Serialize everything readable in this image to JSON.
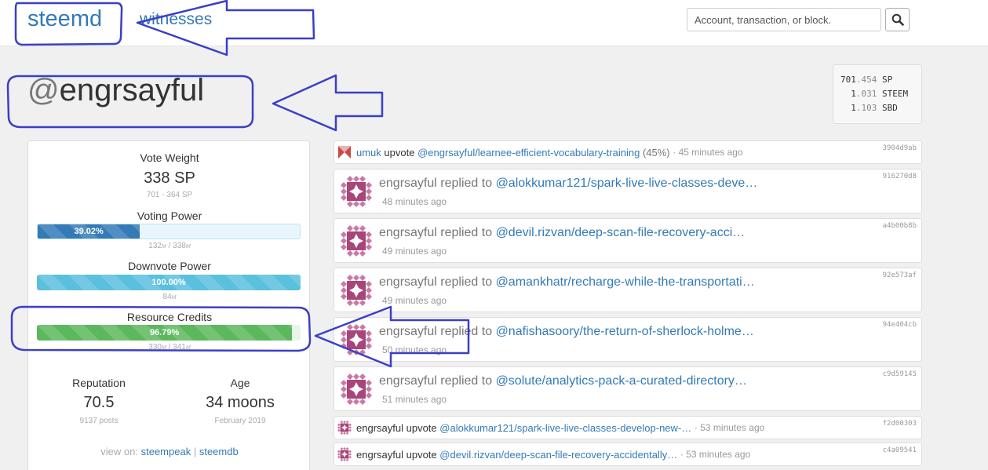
{
  "header": {
    "brand": "steemd",
    "nav_witnesses": "witnesses",
    "search_placeholder": "Account, transaction, or block."
  },
  "account": {
    "at": "@",
    "name": "engrsayful"
  },
  "balances": [
    {
      "int": "701",
      "dec": ".454",
      "unit": "SP"
    },
    {
      "int": "1",
      "dec": ".031",
      "unit": "STEEM"
    },
    {
      "int": "1",
      "dec": ".103",
      "unit": "SBD"
    }
  ],
  "sidebar": {
    "vote_weight": {
      "label": "Vote Weight",
      "value": "338 SP",
      "sub": "701 - 364 SP"
    },
    "voting_power": {
      "label": "Voting Power",
      "percent": 39.02,
      "percent_label": "39.02%",
      "cur": "132",
      "max": "338",
      "unit": "M"
    },
    "downvote_power": {
      "label": "Downvote Power",
      "percent": 100,
      "percent_label": "100.00%",
      "cur": "84",
      "unit": "M"
    },
    "resource_credits": {
      "label": "Resource Credits",
      "percent": 96.79,
      "percent_label": "96.79%",
      "cur": "330",
      "max": "341",
      "unit": "M"
    },
    "reputation": {
      "label": "Reputation",
      "value": "70.5",
      "sub": "9137 posts"
    },
    "age": {
      "label": "Age",
      "value": "34 moons",
      "sub": "February 2019"
    },
    "view_on": {
      "prefix": "view on:",
      "link1": "steempeak",
      "sep": "|",
      "link2": "steemdb"
    }
  },
  "feed": [
    {
      "kind": "small",
      "avatar": "red",
      "user": "umuk",
      "action": "upvote",
      "link": "@engrsayful/learnee-efficient-vocabulary-training",
      "extra": "(45%)",
      "time": "45 minutes ago",
      "hash": "3904d9ab"
    },
    {
      "kind": "big",
      "user": "engrsayful",
      "action": "replied to",
      "link": "@alokkumar121/spark-live-live-classes-deve…",
      "time": "48 minutes ago",
      "hash": "916270d8"
    },
    {
      "kind": "big",
      "user": "engrsayful",
      "action": "replied to",
      "link": "@devil.rizvan/deep-scan-file-recovery-acci…",
      "time": "49 minutes ago",
      "hash": "a4b00b8b"
    },
    {
      "kind": "big",
      "user": "engrsayful",
      "action": "replied to",
      "link": "@amankhatr/recharge-while-the-transportati…",
      "time": "49 minutes ago",
      "hash": "92e573af"
    },
    {
      "kind": "big",
      "user": "engrsayful",
      "action": "replied to",
      "link": "@nafishasoory/the-return-of-sherlock-holme…",
      "time": "50 minutes ago",
      "hash": "94e404cb"
    },
    {
      "kind": "big",
      "user": "engrsayful",
      "action": "replied to",
      "link": "@solute/analytics-pack-a-curated-directory…",
      "time": "51 minutes ago",
      "hash": "c9d59145"
    },
    {
      "kind": "small",
      "avatar": "pink",
      "user": "engrsayful",
      "action": "upvote",
      "link": "@alokkumar121/spark-live-live-classes-develop-new-…",
      "extra": "",
      "time": "53 minutes ago",
      "hash": "f2d00303"
    },
    {
      "kind": "small",
      "avatar": "pink",
      "user": "engrsayful",
      "action": "upvote",
      "link": "@devil.rizvan/deep-scan-file-recovery-accidentally…",
      "extra": "",
      "time": "53 minutes ago",
      "hash": "c4a09541"
    }
  ],
  "colors": {
    "link": "#337ab7",
    "voting_bar": "#337ab7",
    "downvote_bar": "#5bc0de",
    "rc_bar": "#5cb85c",
    "annotation": "#3b3fc6"
  },
  "icons": {
    "search": "search-icon",
    "avatar": "identicon-avatar",
    "annotations": "arrow-annotation"
  }
}
